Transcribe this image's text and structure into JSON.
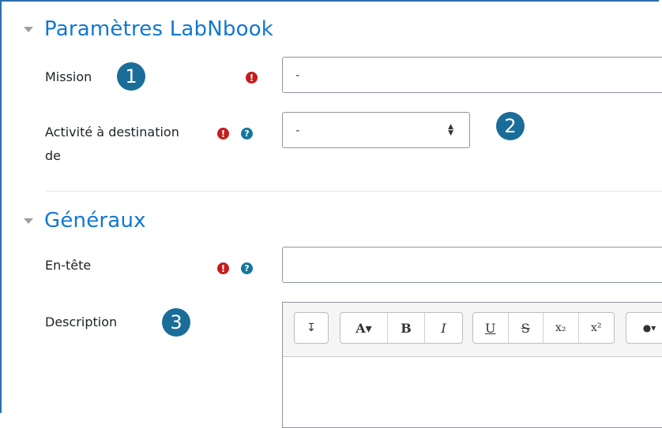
{
  "sections": {
    "labnbook": {
      "title": "Paramètres LabNbook"
    },
    "general": {
      "title": "Généraux"
    }
  },
  "fields": {
    "mission": {
      "label": "Mission",
      "value": "-"
    },
    "activity": {
      "label_line1": "Activité à destination",
      "label_line2": "de",
      "value": "-"
    },
    "header": {
      "label": "En-tête",
      "value": ""
    },
    "description": {
      "label": "Description"
    }
  },
  "badges": {
    "one": "1",
    "two": "2",
    "three": "3"
  },
  "icons": {
    "required": "!",
    "help": "?"
  },
  "toolbar": {
    "buttons": [
      {
        "name": "collapse-toolbar-button",
        "glyph": "↧"
      },
      {
        "name": "font-color-button",
        "glyph": "A▾"
      },
      {
        "name": "bold-button",
        "glyph": "B"
      },
      {
        "name": "italic-button",
        "glyph": "I"
      },
      {
        "name": "underline-button",
        "glyph": "U"
      },
      {
        "name": "strikethrough-button",
        "glyph": "S"
      },
      {
        "name": "subscript-button",
        "glyph": "x₂"
      },
      {
        "name": "superscript-button",
        "glyph": "x²"
      },
      {
        "name": "background-color-button",
        "glyph": "●▾"
      }
    ]
  },
  "colors": {
    "accent": "#1177d1",
    "badge": "#1a6d99",
    "required": "#c51c1c",
    "help": "#15779b"
  }
}
